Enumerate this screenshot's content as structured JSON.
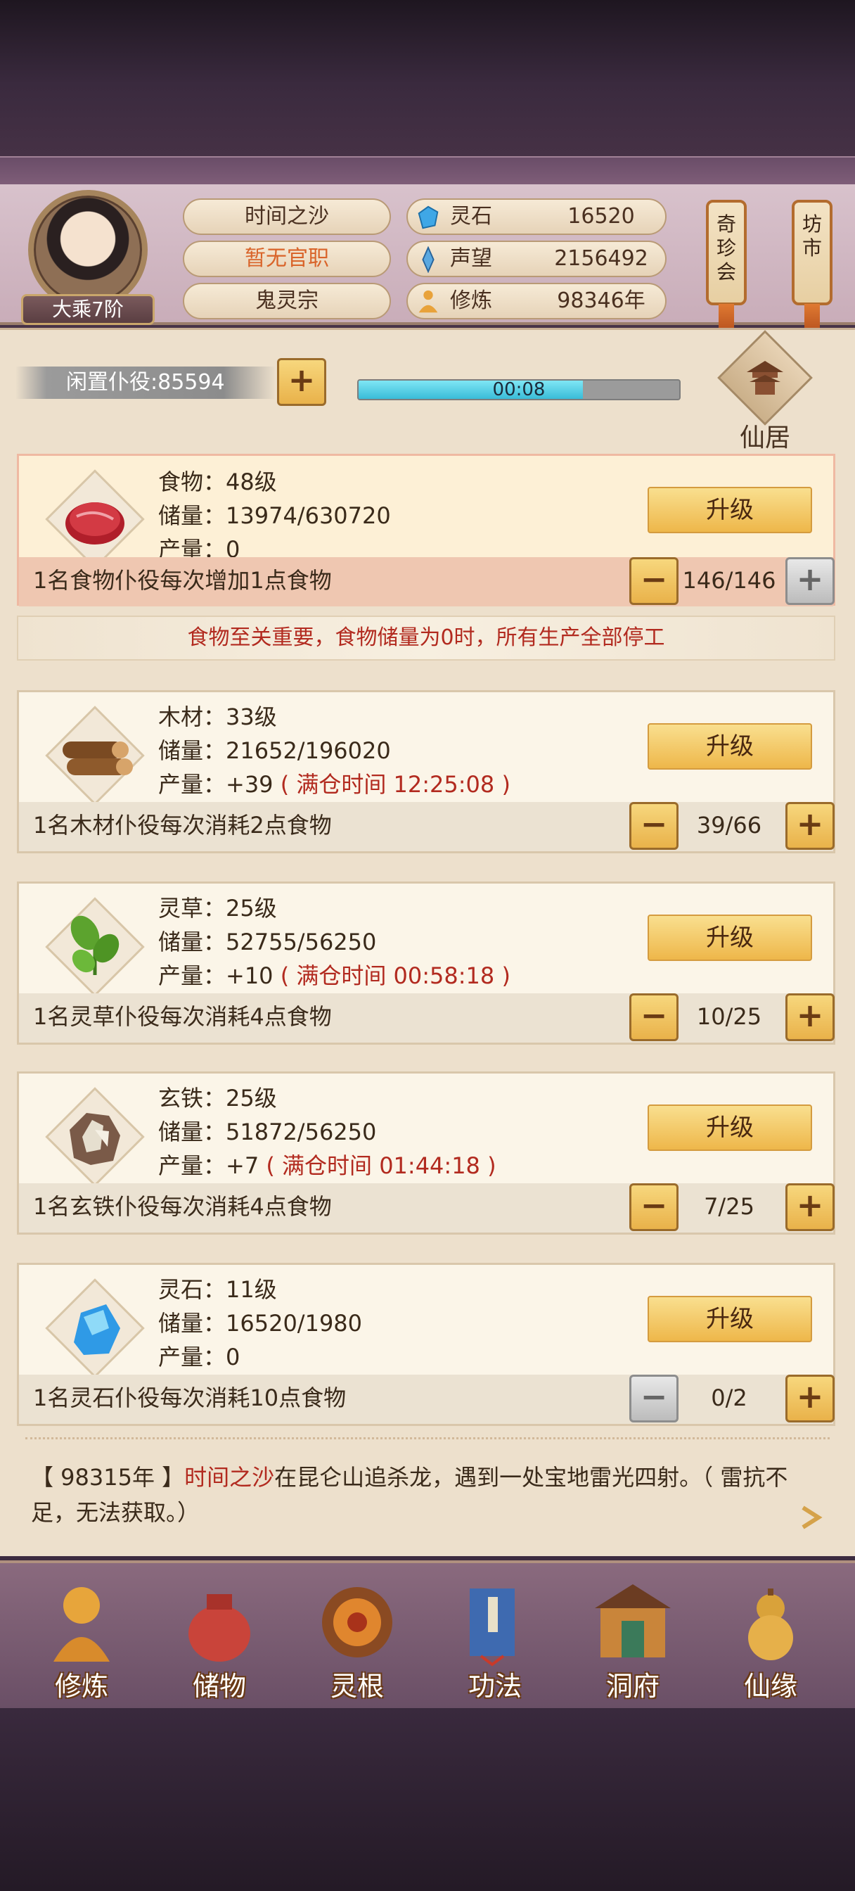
{
  "player": {
    "realm": "大乘7阶",
    "name": "时间之沙",
    "office": "暂无官职",
    "sect": "鬼灵宗"
  },
  "resources": [
    {
      "label": "灵石",
      "value": "16520",
      "icon": "spirit-stone-icon"
    },
    {
      "label": "声望",
      "value": "2156492",
      "icon": "prestige-icon"
    },
    {
      "label": "修炼",
      "value": "98346年",
      "icon": "cultivation-icon"
    }
  ],
  "side_buttons": {
    "qizhenhui": "奇珍会",
    "fangshi": "坊市"
  },
  "idle": {
    "label": "闲置仆役:85594",
    "timer": "00:08",
    "progress": 0.7
  },
  "xianju_label": "仙居",
  "buildings": [
    {
      "name": "食物：48级",
      "storage": "储量：13974/630720",
      "output": "产量：0",
      "full_time": "",
      "upgrade": "升级",
      "note": "1名食物仆役每次增加1点食物",
      "count": "146/146",
      "icon": "meat-icon"
    },
    {
      "name": "木材：33级",
      "storage": "储量：21652/196020",
      "output": "产量：+39",
      "full_time": "( 满仓时间 12:25:08 )",
      "upgrade": "升级",
      "note": "1名木材仆役每次消耗2点食物",
      "count": "39/66",
      "icon": "wood-logs-icon"
    },
    {
      "name": "灵草：25级",
      "storage": "储量：52755/56250",
      "output": "产量：+10",
      "full_time": "( 满仓时间 00:58:18 )",
      "upgrade": "升级",
      "note": "1名灵草仆役每次消耗4点食物",
      "count": "10/25",
      "icon": "herb-icon"
    },
    {
      "name": "玄铁：25级",
      "storage": "储量：51872/56250",
      "output": "产量：+7",
      "full_time": "( 满仓时间 01:44:18 )",
      "upgrade": "升级",
      "note": "1名玄铁仆役每次消耗4点食物",
      "count": "7/25",
      "icon": "iron-ore-icon"
    },
    {
      "name": "灵石：11级",
      "storage": "储量：16520/1980",
      "output": "产量：0",
      "full_time": "",
      "upgrade": "升级",
      "note": "1名灵石仆役每次消耗10点食物",
      "count": "0/2",
      "icon": "crystal-icon"
    }
  ],
  "warning": "食物至关重要，食物储量为0时，所有生产全部停工",
  "log": {
    "year": "【 98315年 】",
    "name": "时间之沙",
    "text": "在昆仑山追杀龙，遇到一处宝地雷光四射。（ 雷抗不足，无法获取。）"
  },
  "nav": [
    "修炼",
    "储物",
    "灵根",
    "功法",
    "洞府",
    "仙缘"
  ],
  "colors": {
    "accent_red": "#b22a1f",
    "gold": "#eeb74a",
    "progress": "#39bcd8"
  }
}
